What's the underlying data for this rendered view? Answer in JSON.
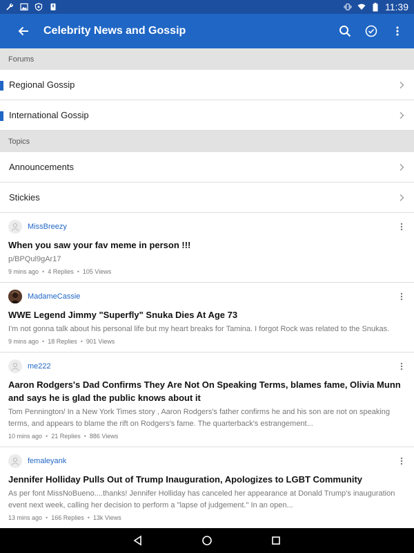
{
  "status_bar": {
    "time": "11:39",
    "left_icons": [
      "wrench-icon",
      "image-icon",
      "shield-icon",
      "sd-card-icon"
    ],
    "right_icons": [
      "vibrate-icon",
      "wifi-icon",
      "battery-icon"
    ]
  },
  "app_bar": {
    "title": "Celebrity News and Gossip",
    "back_icon": "arrow-left-icon",
    "actions": [
      "search-icon",
      "check-circle-icon",
      "more-vert-icon"
    ]
  },
  "forums": {
    "header": "Forums",
    "items": [
      {
        "label": "Regional Gossip"
      },
      {
        "label": "International Gossip"
      }
    ]
  },
  "topics_section": {
    "header": "Topics",
    "items": [
      {
        "label": "Announcements"
      },
      {
        "label": "Stickies"
      }
    ]
  },
  "topics": [
    {
      "author": "MissBreezy",
      "title": "When you saw your fav meme in person !!!",
      "snippet": "p/BPQul9gAr17",
      "time": "9 mins ago",
      "replies": "4 Replies",
      "views": "105 Views"
    },
    {
      "author": "MadameCassie",
      "title": "WWE Legend Jimmy \"Superfly\" Snuka Dies At Age 73",
      "snippet": "I'm not gonna talk about his personal life but my heart breaks for Tamina. I forgot Rock was related to the Snukas.",
      "time": "9 mins ago",
      "replies": "18 Replies",
      "views": "901 Views"
    },
    {
      "author": "me222",
      "title": "Aaron Rodgers's Dad Confirms They Are Not On Speaking Terms, blames fame, Olivia Munn and says he is glad the public knows about it",
      "snippet": "Tom Pennington/ In a New York Times story , Aaron Rodgers's father confirms he and his son are not on speaking terms, and appears to blame the rift on Rodgers's fame. The quarterback's estrangement...",
      "time": "10 mins ago",
      "replies": "21 Replies",
      "views": "886 Views"
    },
    {
      "author": "femaleyank",
      "title": "Jennifer Holliday Pulls Out of Trump Inauguration, Apologizes to LGBT Community",
      "snippet": "As per font MissNoBueno....thanks! Jennifer Holliday has canceled her appearance at Donald Trump's inauguration event next week, calling her decision to perform a \"lapse of judgement.\" In an open...",
      "time": "13 mins ago",
      "replies": "166 Replies",
      "views": "13k Views"
    }
  ],
  "nav_bar": {
    "buttons": [
      "back-triangle-icon",
      "home-circle-icon",
      "recents-square-icon"
    ]
  },
  "colors": {
    "status_bar": "#1c4fa0",
    "app_bar": "#1f66c5",
    "accent": "#1f66c5",
    "section_header": "#e2e2e2"
  }
}
